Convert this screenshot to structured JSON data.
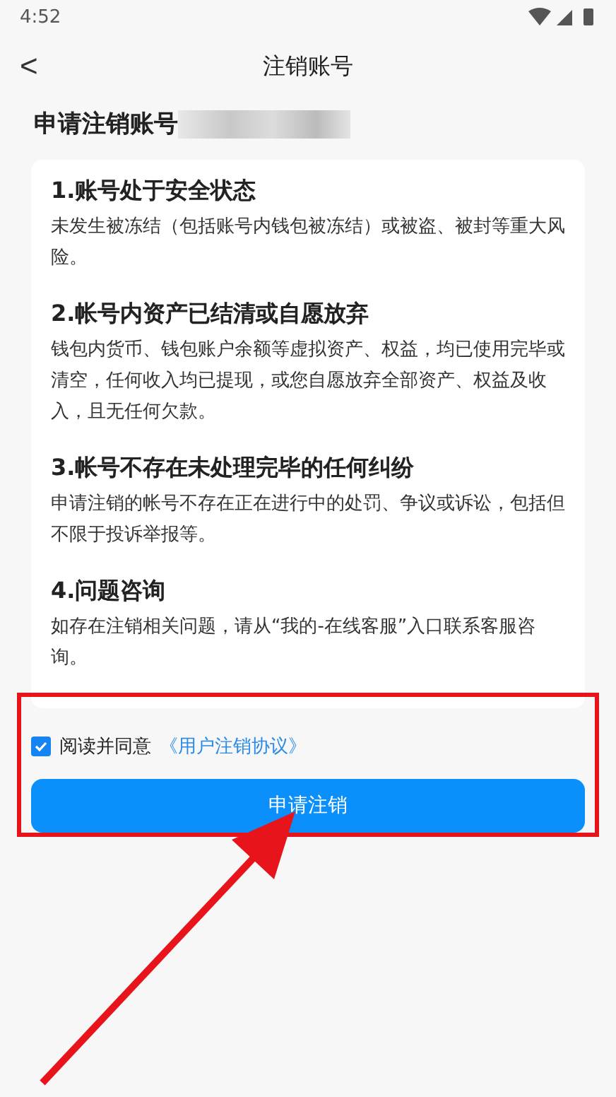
{
  "status_bar": {
    "time": "4:52"
  },
  "header": {
    "back": "<",
    "title": "注销账号"
  },
  "heading": {
    "title": "申请注销账号"
  },
  "sections": [
    {
      "title": "1.账号处于安全状态",
      "body": "未发生被冻结（包括账号内钱包被冻结）或被盗、被封等重大风险。"
    },
    {
      "title": "2.帐号内资产已结清或自愿放弃",
      "body": "钱包内货币、钱包账户余额等虚拟资产、权益，均已使用完毕或清空，任何收入均已提现，或您自愿放弃全部资产、权益及收入，且无任何欠款。"
    },
    {
      "title": "3.帐号不存在未处理完毕的任何纠纷",
      "body": "申请注销的帐号不存在正在进行中的处罚、争议或诉讼，包括但不限于投诉举报等。"
    },
    {
      "title": "4.问题咨询",
      "body": "如存在注销相关问题，请从“我的-在线客服”入口联系客服咨询。"
    }
  ],
  "agreement": {
    "checked": true,
    "label": "阅读并同意",
    "link": "《用户注销协议》"
  },
  "submit_button": "申请注销"
}
